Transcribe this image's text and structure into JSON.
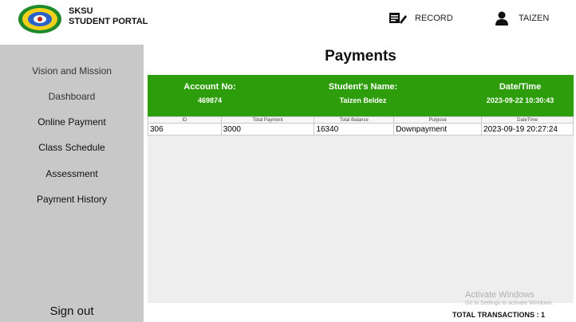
{
  "header": {
    "brand_line1": "SKSU",
    "brand_line2": "STUDENT PORTAL",
    "record_label": "RECORD",
    "user_name": "TAIZEN"
  },
  "sidebar": {
    "items": [
      {
        "label": "Vision and Mission"
      },
      {
        "label": "Dashboard"
      },
      {
        "label": "Online Payment"
      },
      {
        "label": "Class Schedule"
      },
      {
        "label": "Assessment"
      },
      {
        "label": "Payment History"
      }
    ],
    "signout_label": "Sign out"
  },
  "main": {
    "title": "Payments",
    "info": {
      "account_label": "Account No:",
      "account_value": "469874",
      "name_label": "Student's Name:",
      "name_value": "Taizen Beldez",
      "date_label": "Date/Time",
      "date_value": "2023-09-22 10:30:43"
    },
    "table": {
      "columns": [
        "ID",
        "Total Payment",
        "Total Balance",
        "Purpose",
        "DateTime"
      ],
      "rows": [
        [
          "306",
          "3000",
          "16340",
          "Downpayment",
          "2023-09-19 20:27:24"
        ]
      ]
    },
    "watermark": {
      "line1": "Activate Windows",
      "line2": "Go to Settings to activate Windows."
    },
    "total_transactions": "TOTAL TRANSACTIONS : 1"
  },
  "colors": {
    "accent_green": "#2e9d0b",
    "sidebar_gray": "#c8c8c8"
  }
}
